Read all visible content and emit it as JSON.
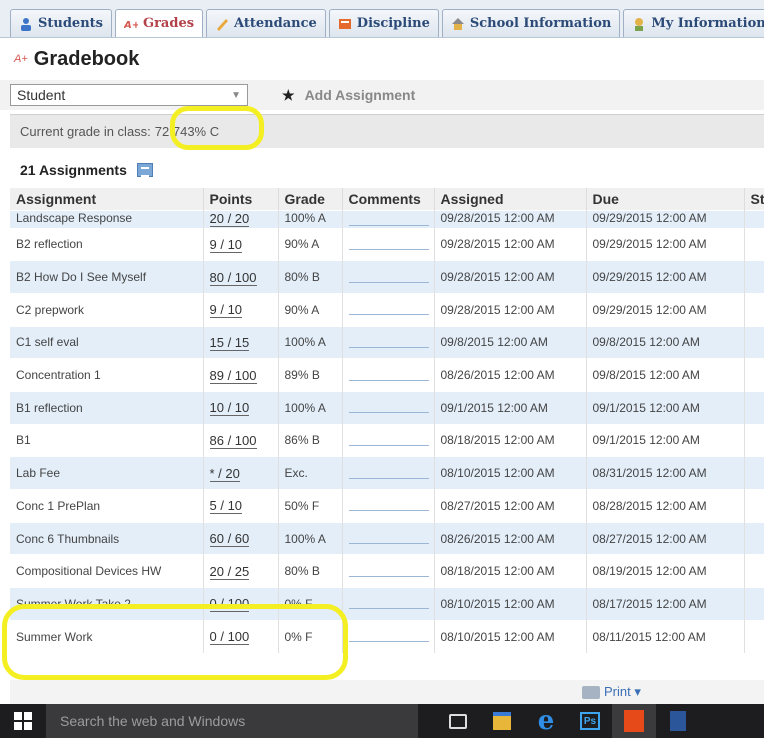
{
  "nav": {
    "tabs": [
      {
        "label": "Students",
        "icon": "students-icon"
      },
      {
        "label": "Grades",
        "icon": "grades-icon",
        "active": true
      },
      {
        "label": "Attendance",
        "icon": "attendance-icon"
      },
      {
        "label": "Discipline",
        "icon": "discipline-icon"
      },
      {
        "label": "School Information",
        "icon": "school-icon"
      },
      {
        "label": "My Information",
        "icon": "my-info-icon"
      }
    ]
  },
  "page": {
    "title": "Gradebook"
  },
  "controls": {
    "student_select_value": "Student",
    "add_assignment_label": "Add Assignment"
  },
  "current_grade": {
    "label": "Current grade in class:",
    "value": "72.743% C"
  },
  "assignments": {
    "count_label": "21 Assignments",
    "columns": [
      "Assignment",
      "Points",
      "Grade",
      "Comments",
      "Assigned",
      "Due",
      "St"
    ],
    "rows": [
      {
        "assignment": "Landscape Response",
        "points": "20 / 20",
        "grade": "100% A",
        "assigned": "09/28/2015 12:00 AM",
        "due": "09/29/2015 12:00 AM"
      },
      {
        "assignment": "B2 reflection",
        "points": "9 / 10",
        "grade": "90% A",
        "assigned": "09/28/2015 12:00 AM",
        "due": "09/29/2015 12:00 AM"
      },
      {
        "assignment": "B2 How Do I See Myself",
        "points": "80 / 100",
        "grade": "80% B",
        "assigned": "09/28/2015 12:00 AM",
        "due": "09/29/2015 12:00 AM"
      },
      {
        "assignment": "C2 prepwork",
        "points": "9 / 10",
        "grade": "90% A",
        "assigned": "09/28/2015 12:00 AM",
        "due": "09/29/2015 12:00 AM"
      },
      {
        "assignment": "C1 self eval",
        "points": "15 / 15",
        "grade": "100% A",
        "assigned": "09/8/2015 12:00 AM",
        "due": "09/8/2015 12:00 AM"
      },
      {
        "assignment": "Concentration 1",
        "points": "89 / 100",
        "grade": "89% B",
        "assigned": "08/26/2015 12:00 AM",
        "due": "09/8/2015 12:00 AM"
      },
      {
        "assignment": "B1 reflection",
        "points": "10 / 10",
        "grade": "100% A",
        "assigned": "09/1/2015 12:00 AM",
        "due": "09/1/2015 12:00 AM"
      },
      {
        "assignment": "B1",
        "points": "86 / 100",
        "grade": "86% B",
        "assigned": "08/18/2015 12:00 AM",
        "due": "09/1/2015 12:00 AM"
      },
      {
        "assignment": "Lab Fee",
        "points": "* / 20",
        "grade": "Exc.",
        "assigned": "08/10/2015 12:00 AM",
        "due": "08/31/2015 12:00 AM"
      },
      {
        "assignment": "Conc 1 PrePlan",
        "points": "5 / 10",
        "grade": "50% F",
        "assigned": "08/27/2015 12:00 AM",
        "due": "08/28/2015 12:00 AM"
      },
      {
        "assignment": "Conc 6 Thumbnails",
        "points": "60 / 60",
        "grade": "100% A",
        "assigned": "08/26/2015 12:00 AM",
        "due": "08/27/2015 12:00 AM"
      },
      {
        "assignment": "Compositional Devices HW",
        "points": "20 / 25",
        "grade": "80% B",
        "assigned": "08/18/2015 12:00 AM",
        "due": "08/19/2015 12:00 AM"
      },
      {
        "assignment": "Summer Work Take 2",
        "points": "0 / 100",
        "grade": "0% F",
        "assigned": "08/10/2015 12:00 AM",
        "due": "08/17/2015 12:00 AM"
      },
      {
        "assignment": "Summer Work",
        "points": "0 / 100",
        "grade": "0% F",
        "assigned": "08/10/2015 12:00 AM",
        "due": "08/11/2015 12:00 AM"
      }
    ]
  },
  "footer": {
    "print_label": "Print ▾"
  },
  "taskbar": {
    "search_placeholder": "Search the web and Windows"
  },
  "colors": {
    "highlight": "#f4ef22",
    "row_alt": "#e3eef9",
    "tab_text": "#2b4a77"
  }
}
